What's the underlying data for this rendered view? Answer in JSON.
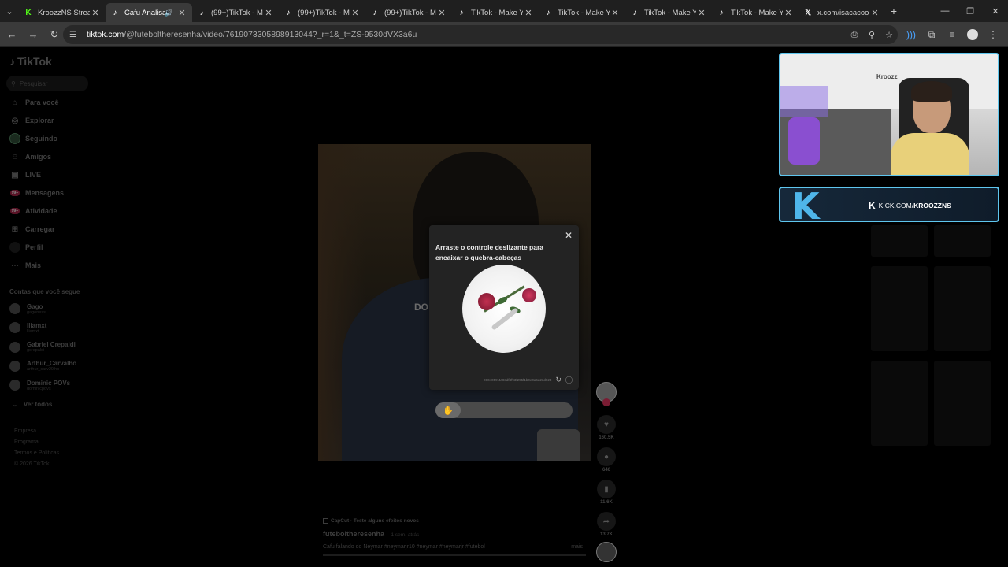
{
  "browser": {
    "tabs": [
      {
        "title": "KroozzNS Stream",
        "icon": "kick-icon",
        "active": false
      },
      {
        "title": "Cafu Analisa a",
        "icon": "tiktok-icon",
        "active": true,
        "audio": true
      },
      {
        "title": "(99+)TikTok - Ma",
        "icon": "tiktok-icon",
        "active": false
      },
      {
        "title": "(99+)TikTok - Ma",
        "icon": "tiktok-icon",
        "active": false
      },
      {
        "title": "(99+)TikTok - Ma",
        "icon": "tiktok-icon",
        "active": false
      },
      {
        "title": "TikTok - Make Yo",
        "icon": "tiktok-icon",
        "active": false
      },
      {
        "title": "TikTok - Make Yo",
        "icon": "tiktok-icon",
        "active": false
      },
      {
        "title": "TikTok - Make Yo",
        "icon": "tiktok-icon",
        "active": false
      },
      {
        "title": "TikTok - Make Yo",
        "icon": "tiktok-icon",
        "active": false
      },
      {
        "title": "x.com/isacacoo/s",
        "icon": "x-icon",
        "active": false
      }
    ],
    "url_host": "tiktok.com",
    "url_path": "/@futeboltheresenha/video/7619073305898913044?_r=1&_t=ZS-9530dVX3a6u"
  },
  "tiktok": {
    "logo": "TikTok",
    "search_placeholder": "Pesquisar",
    "nav": [
      {
        "label": "Para você",
        "icon": "home-icon"
      },
      {
        "label": "Explorar",
        "icon": "compass-icon"
      },
      {
        "label": "Seguindo",
        "icon": "following-icon"
      },
      {
        "label": "Amigos",
        "icon": "friends-icon"
      },
      {
        "label": "LIVE",
        "icon": "live-icon"
      },
      {
        "label": "Mensagens",
        "icon": "messages-icon",
        "badge": "99+"
      },
      {
        "label": "Atividade",
        "icon": "activity-icon",
        "badge": "99+"
      },
      {
        "label": "Carregar",
        "icon": "upload-icon"
      },
      {
        "label": "Perfil",
        "icon": "profile-icon"
      },
      {
        "label": "Mais",
        "icon": "more-icon"
      }
    ],
    "following_title": "Contas que você segue",
    "accounts": [
      {
        "name": "Gago",
        "handle": "gagoness"
      },
      {
        "name": "lliamxt",
        "handle": "lliamxt"
      },
      {
        "name": "Gabriel Crepaldi",
        "handle": "gcrepaldi"
      },
      {
        "name": "Arthur_Carvalho",
        "handle": "arthur_carv29lho"
      },
      {
        "name": "Dominic POVs",
        "handle": "dominicpovs"
      }
    ],
    "see_all": "Ver todos",
    "footer": [
      "Empresa",
      "Programa",
      "Termos e Políticas",
      "© 2026 TikTok"
    ],
    "video_overlay_text": "DO",
    "actions": {
      "likes": "160.5K",
      "comments": "646",
      "saves": "11.6K",
      "shares": "13.7K"
    },
    "capcut": "CapCut · Teste alguns efeitos novos",
    "author": "futeboltheresenha",
    "posted": "· 1 sem. atrás",
    "caption": "Cafu falando do Neymar #neymarjr10 #neymar #neymarjr #futebol",
    "more": "mais"
  },
  "captcha": {
    "title": "Arraste o controle deslizante para encaixar o quebra-cabeças",
    "code": "0604059f4a03df4f93f295f1b0e0a6a23d923"
  },
  "stream": {
    "wall_logo": "Kroozz",
    "kick_url_prefix": "KICK.COM/",
    "kick_url_name": "KROOZZNS",
    "accent": "#5fc6ee"
  }
}
